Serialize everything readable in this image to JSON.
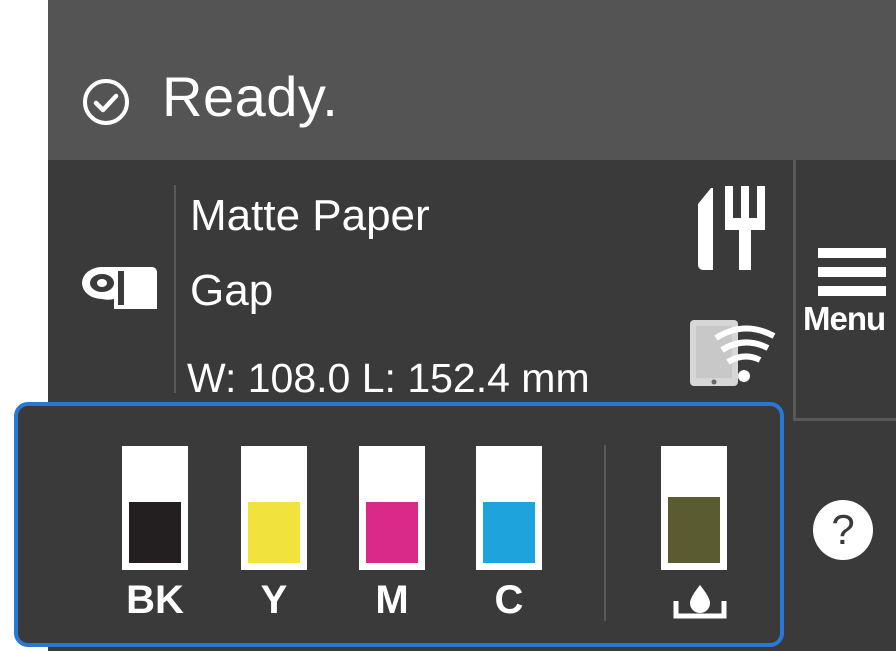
{
  "status": {
    "icon": "check-circle-icon",
    "text": "Ready."
  },
  "paper": {
    "icon": "roll-paper-icon",
    "type": "Matte Paper",
    "gap": "Gap",
    "size": "W: 108.0   L: 152.4 mm"
  },
  "icons": {
    "maintenance": "maintenance-tool-icon",
    "wifi": "wifi-device-icon",
    "menu": "hamburger-menu-icon",
    "maintenance_box": "maintenance-box-icon"
  },
  "menu": {
    "label": "Menu"
  },
  "help": {
    "label": "?"
  },
  "inks": [
    {
      "label": "BK",
      "level": 0.55,
      "color": "#231f20"
    },
    {
      "label": "Y",
      "level": 0.55,
      "color": "#f2e23d"
    },
    {
      "label": "M",
      "level": 0.55,
      "color": "#d92a8a"
    },
    {
      "label": "C",
      "level": 0.55,
      "color": "#1fa3dc"
    },
    {
      "label": "",
      "level": 0.6,
      "color": "#5a5b31"
    }
  ],
  "colors": {
    "accent": "#2a78d6",
    "status_bg": "#545454",
    "panel_bg": "#3a3a3a"
  }
}
